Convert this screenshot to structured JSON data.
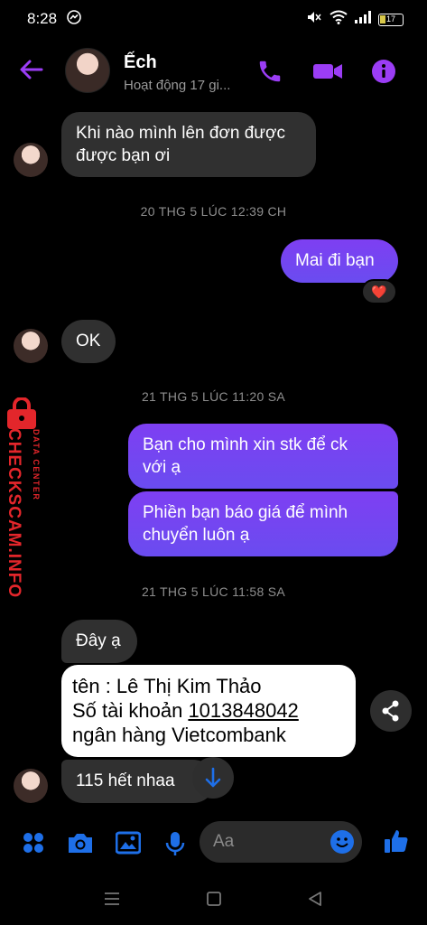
{
  "status": {
    "time": "8:28",
    "battery": "17"
  },
  "header": {
    "name": "Ếch",
    "status": "Hoạt động 17 gi..."
  },
  "messages": [
    {
      "side": "in",
      "lines": [
        "Khi nào mình lên đơn được",
        "được bạn ơi"
      ]
    },
    {
      "timestamp": "20 THG 5 LÚC 12:39 CH"
    },
    {
      "side": "out",
      "lines": [
        "Mai đi bạn"
      ],
      "reaction": "❤️"
    },
    {
      "side": "in",
      "lines": [
        "OK"
      ]
    },
    {
      "timestamp": "21 THG 5 LÚC 11:20 SA"
    },
    {
      "side": "out",
      "lines": [
        "Bạn cho mình xin stk để ck",
        "với ạ"
      ]
    },
    {
      "side": "out",
      "lines": [
        "Phiền bạn báo giá để mình",
        "chuyển luôn ạ"
      ]
    },
    {
      "timestamp": "21 THG 5 LÚC 11:58 SA"
    },
    {
      "side": "in",
      "lines": [
        "Đây ạ"
      ]
    },
    {
      "side": "in",
      "kind": "bank-card",
      "lines": [
        "tên : Lê Thị Kim Thảo",
        "Số tài khoản ",
        "1013848042",
        "ngân hàng Vietcombank"
      ]
    },
    {
      "side": "in",
      "lines": [
        "115 hết nhaa"
      ]
    }
  ],
  "watermark": {
    "site": "CHECKSCAM.INFO",
    "sub": "DATA CENTER"
  },
  "composer": {
    "placeholder": "Aa"
  },
  "colors": {
    "accent": "#8a2be2",
    "out_bubble": "#7446f0",
    "in_bubble": "#303030",
    "composer_icons": "#1e6fe8"
  }
}
